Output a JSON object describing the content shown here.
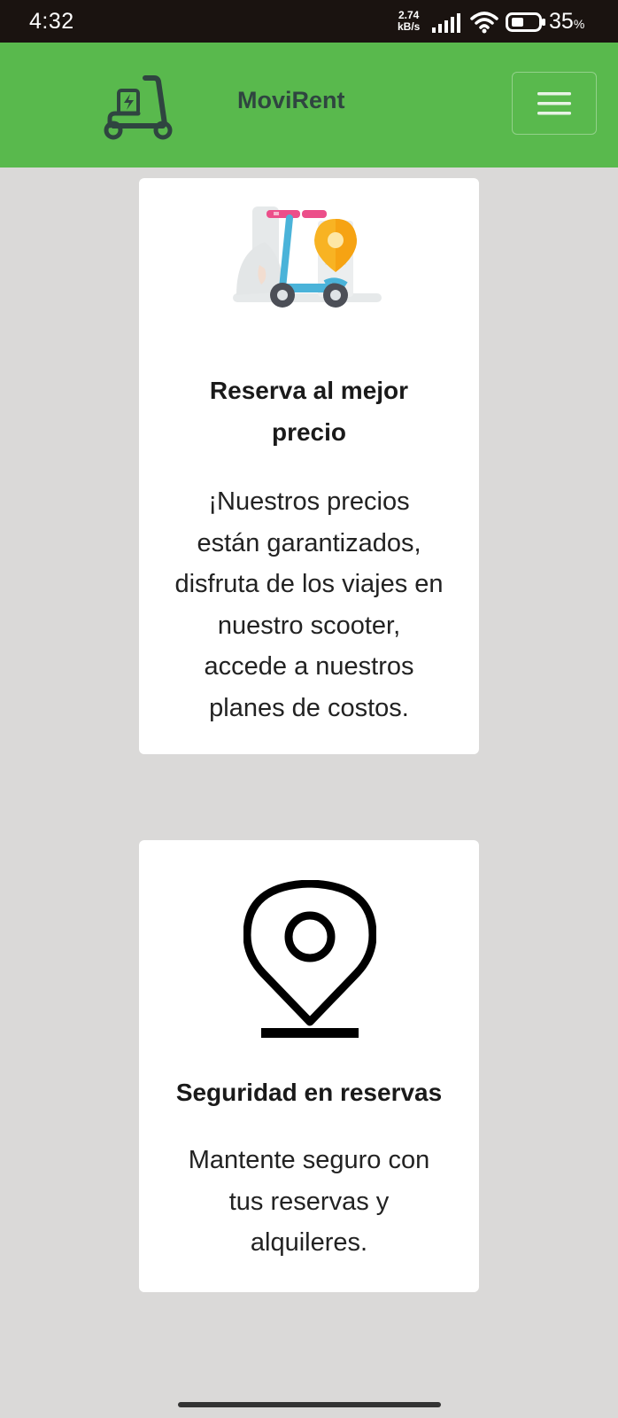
{
  "status_bar": {
    "time": "4:32",
    "speed_value": "2.74",
    "speed_unit": "kB/s",
    "battery_percent": "35",
    "battery_sign": "%"
  },
  "header": {
    "brand": "MoviRent",
    "logo_icon": "electric-scooter-icon",
    "menu_icon": "hamburger-menu-icon",
    "background_color": "#59b94d"
  },
  "cards": [
    {
      "icon": "scooter-location-illustration",
      "title_line1": "Reserva al mejor",
      "title_line2": "precio",
      "text_lines": [
        "¡Nuestros precios",
        "están garantizados,",
        "disfruta de los viajes en",
        "nuestro scooter,",
        "accede a nuestros",
        "planes de costos."
      ]
    },
    {
      "icon": "map-pin-icon",
      "title_line1": "Seguridad en reservas",
      "text_lines": [
        "Mantente seguro con",
        "tus reservas y",
        "alquileres."
      ]
    }
  ]
}
